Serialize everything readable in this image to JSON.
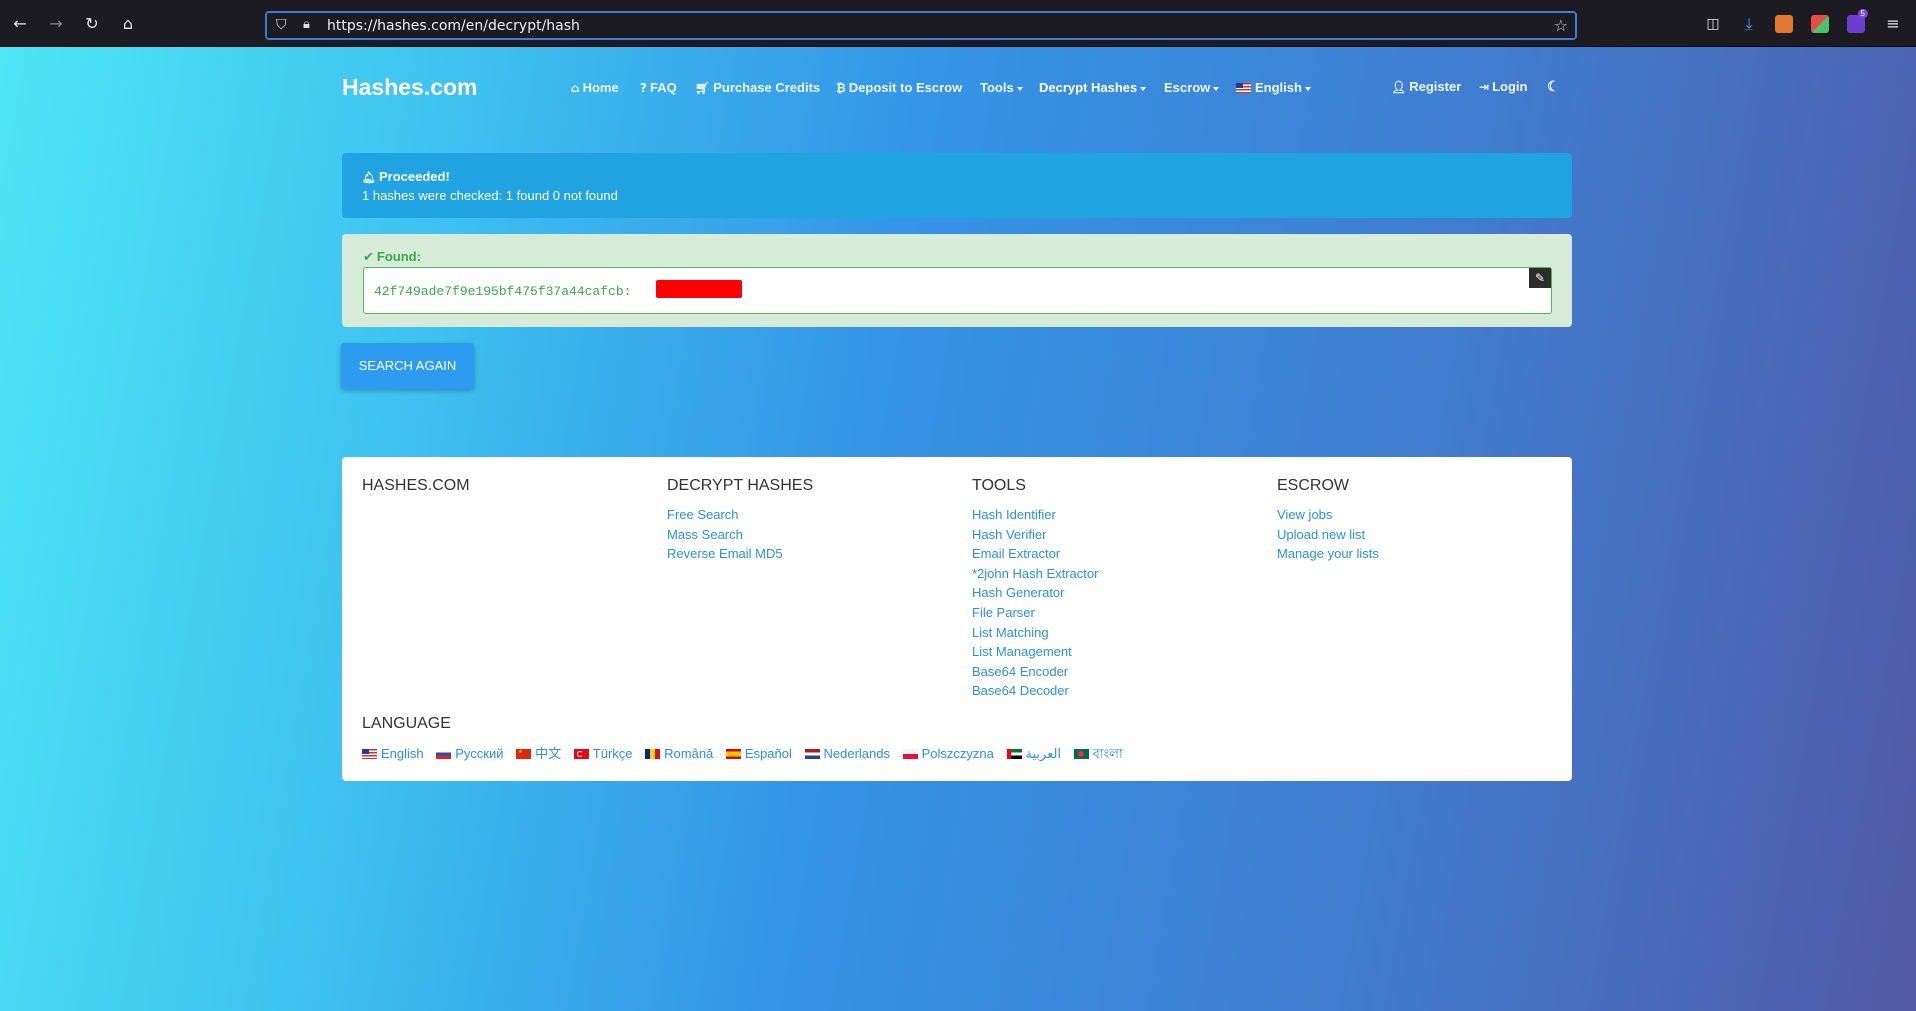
{
  "browser": {
    "url": "https://hashes.com/en/decrypt/hash",
    "badge_count": "5"
  },
  "nav": {
    "brand": "Hashes.com",
    "home": "Home",
    "faq": "FAQ",
    "purchase": "Purchase Credits",
    "deposit": "Deposit to Escrow",
    "tools": "Tools",
    "decrypt": "Decrypt Hashes",
    "escrow": "Escrow",
    "language": "English",
    "register": "Register",
    "login": "Login"
  },
  "alert": {
    "title": "Proceeded!",
    "message": "1 hashes were checked: 1 found 0 not found"
  },
  "found": {
    "label": "Found:",
    "hash": "42f749ade7f9e195bf475f37a44cafcb:"
  },
  "search_again": "SEARCH AGAIN",
  "footer": {
    "col1_title": "HASHES.COM",
    "col2_title": "DECRYPT HASHES",
    "col2_links": [
      "Free Search",
      "Mass Search",
      "Reverse Email MD5"
    ],
    "col3_title": "TOOLS",
    "col3_links": [
      "Hash Identifier",
      "Hash Verifier",
      "Email Extractor",
      "*2john Hash Extractor",
      "Hash Generator",
      "File Parser",
      "List Matching",
      "List Management",
      "Base64 Encoder",
      "Base64 Decoder"
    ],
    "col4_title": "ESCROW",
    "col4_links": [
      "View jobs",
      "Upload new list",
      "Manage your lists"
    ],
    "language_title": "LANGUAGE",
    "languages": [
      "English",
      "Русский",
      "中文",
      "Türkçe",
      "Română",
      "Español",
      "Nederlands",
      "Polszczyzna",
      "العربية",
      "বাংলা"
    ]
  }
}
